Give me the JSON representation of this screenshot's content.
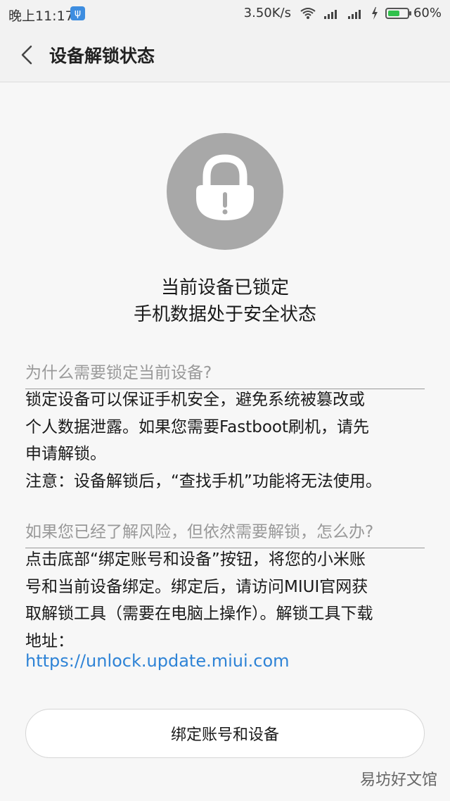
{
  "status_bar": {
    "time": "晚上11:17",
    "speed": "3.50K/s",
    "battery": "60%",
    "battery_level": 0.6,
    "usb_icon": "usb-icon"
  },
  "nav": {
    "title": "设备解锁状态",
    "back_icon": "chevron-left-icon"
  },
  "status": {
    "icon": "lock-icon",
    "line1": "当前设备已锁定",
    "line2": "手机数据处于安全状态"
  },
  "sections": [
    {
      "question": "为什么需要锁定当前设备?",
      "body": "锁定设备可以保证手机安全，避免系统被篡改或\n个人数据泄露。如果您需要Fastboot刷机，请先\n申请解锁。\n注意：设备解锁后，“查找手机”功能将无法使用。"
    },
    {
      "question": "如果您已经了解风险，但依然需要解锁，怎么办?",
      "body": "点击底部“绑定账号和设备”按钮，将您的小米账\n号和当前设备绑定。绑定后，请访问MIUI官网获\n取解锁工具（需要在电脑上操作）。解锁工具下载\n地址：",
      "link": "https://unlock.update.miui.com"
    }
  ],
  "button": {
    "label": "绑定账号和设备"
  },
  "watermark": "易坊好文馆",
  "colors": {
    "accent_link": "#2e83d6",
    "lock_circle": "#a8a8a8",
    "battery_fill": "#2fc14c"
  }
}
